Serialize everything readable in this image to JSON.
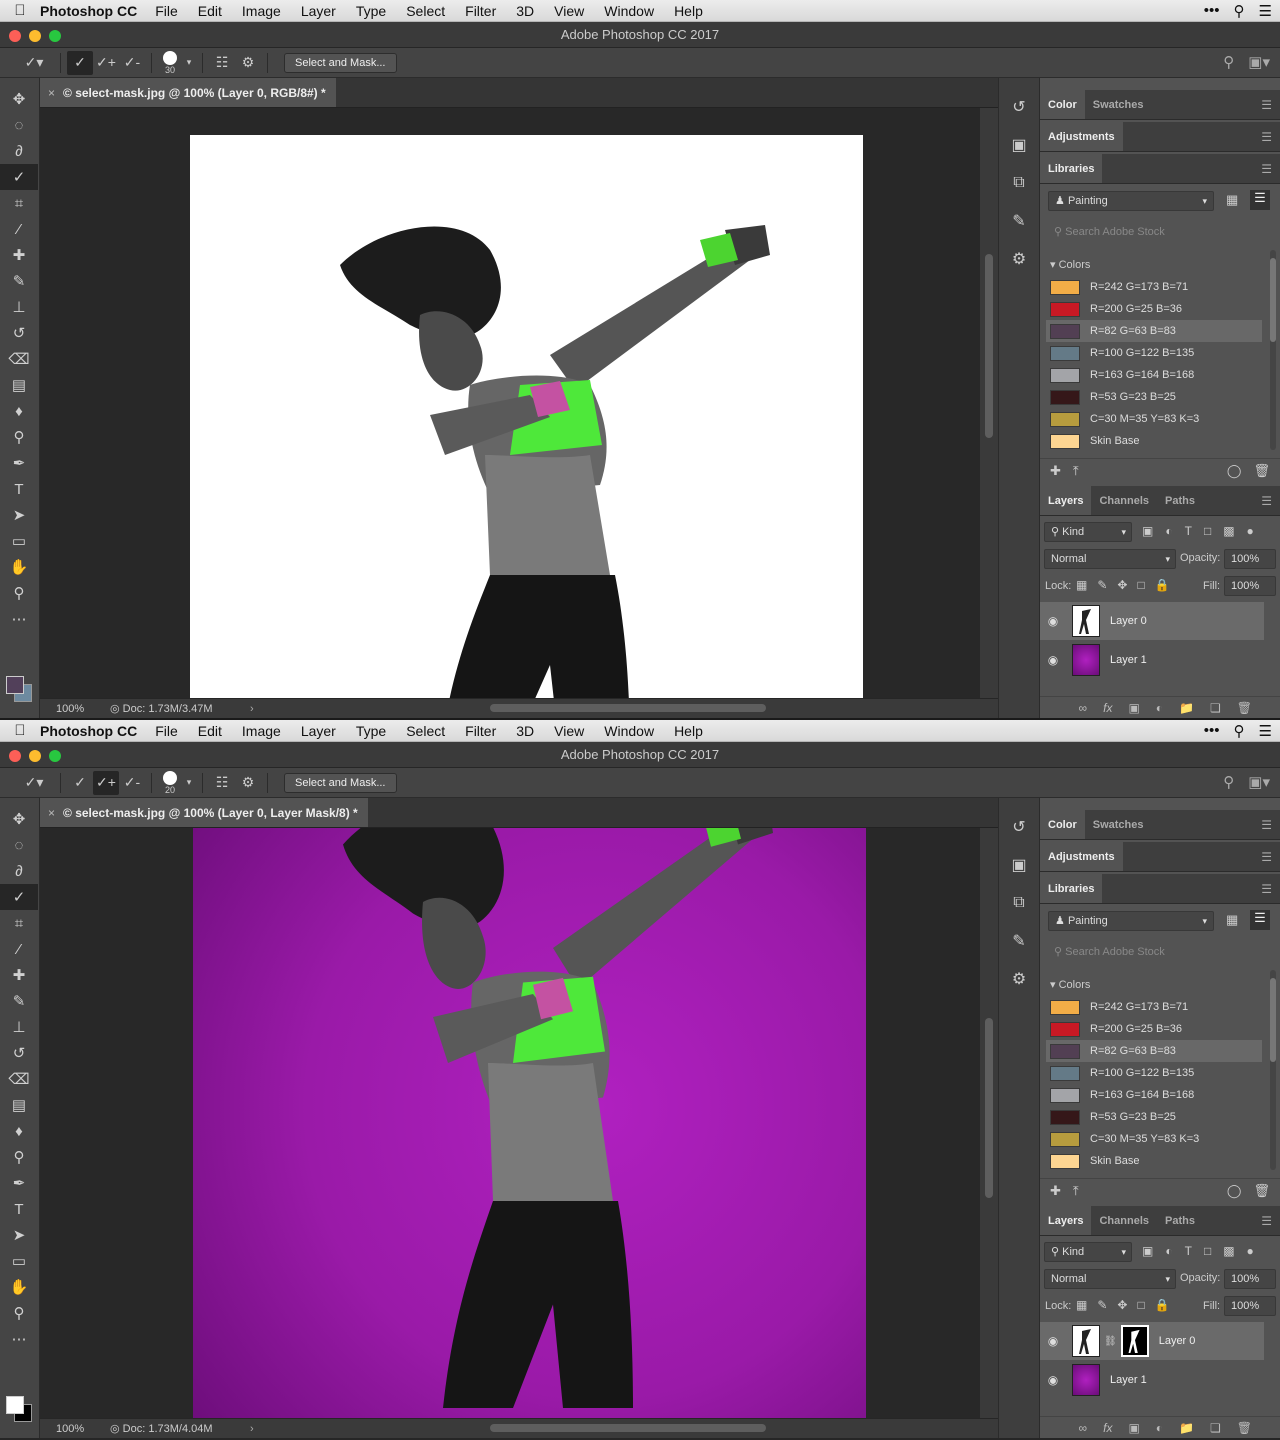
{
  "menubar": {
    "apple_icon": "apple-icon",
    "app_name": "Photoshop CC",
    "items": [
      "File",
      "Edit",
      "Image",
      "Layer",
      "Type",
      "Select",
      "Filter",
      "3D",
      "View",
      "Window",
      "Help"
    ],
    "right_icons": [
      "more-icon",
      "search-icon",
      "list-icon"
    ]
  },
  "screens": [
    {
      "window_title": "Adobe Photoshop CC 2017",
      "brush_size": "30",
      "active_brush_mode": 0,
      "select_and_mask_label": "Select and Mask...",
      "document_tab": "© select-mask.jpg @ 100% (Layer 0, RGB/8#) *",
      "tab_close": "×",
      "canvas_background": "#ffffff",
      "zoom": "100%",
      "doc_info": "Doc: 1.73M/3.47M",
      "layers": [
        {
          "name": "Layer 0",
          "selected": true,
          "has_mask": false
        },
        {
          "name": "Layer 1",
          "selected": false,
          "has_mask": false
        }
      ],
      "foreground_color": "#52405a",
      "background_color": "#6d8aa0"
    },
    {
      "window_title": "Adobe Photoshop CC 2017",
      "brush_size": "20",
      "active_brush_mode": 1,
      "select_and_mask_label": "Select and Mask...",
      "document_tab": "© select-mask.jpg @ 100% (Layer 0, Layer Mask/8) *",
      "tab_close": "×",
      "canvas_background": "#9a1aa8",
      "zoom": "100%",
      "doc_info": "Doc: 1.73M/4.04M",
      "layers": [
        {
          "name": "Layer 0",
          "selected": true,
          "has_mask": true
        },
        {
          "name": "Layer 1",
          "selected": false,
          "has_mask": false
        }
      ],
      "foreground_color": "#ffffff",
      "background_color": "#000000"
    }
  ],
  "panels": {
    "color_tabs": [
      "Color",
      "Swatches"
    ],
    "adjustments_tab": "Adjustments",
    "libraries_tab": "Libraries",
    "library_name": "Painting",
    "search_placeholder": "Search Adobe Stock",
    "colors_heading": "Colors",
    "colors": [
      {
        "label": "R=242 G=173 B=71",
        "hex": "#f2ad47"
      },
      {
        "label": "R=200 G=25 B=36",
        "hex": "#c81924"
      },
      {
        "label": "R=82 G=63 B=83",
        "hex": "#523f53"
      },
      {
        "label": "R=100 G=122 B=135",
        "hex": "#647a87"
      },
      {
        "label": "R=163 G=164 B=168",
        "hex": "#a3a4a8"
      },
      {
        "label": "R=53 G=23 B=25",
        "hex": "#351719"
      },
      {
        "label": "C=30 M=35 Y=83 K=3",
        "hex": "#b79c3e"
      },
      {
        "label": "Skin Base",
        "hex": "#fdd592"
      }
    ],
    "highlighted_color_index": 2,
    "layer_tabs": [
      "Layers",
      "Channels",
      "Paths"
    ],
    "kind_label": "Kind",
    "blend_mode": "Normal",
    "opacity_label": "Opacity:",
    "opacity_value": "100%",
    "lock_label": "Lock:",
    "fill_label": "Fill:",
    "fill_value": "100%"
  }
}
